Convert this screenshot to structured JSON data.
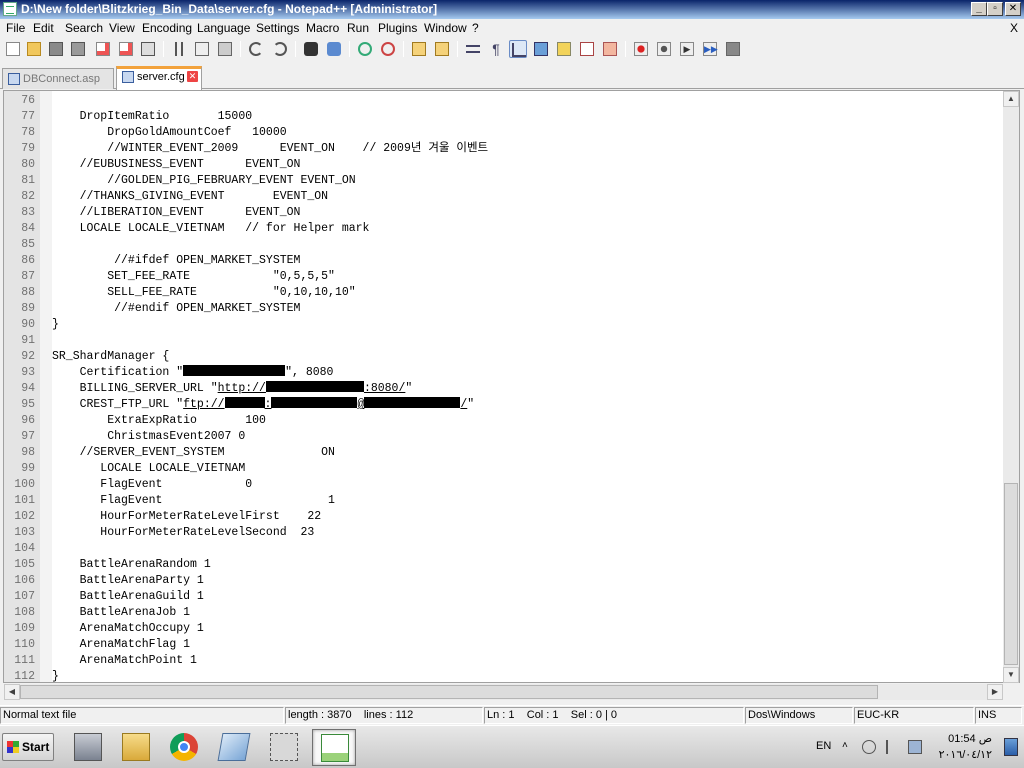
{
  "window": {
    "title": "D:\\New folder\\Blitzkrieg_Bin_Data\\server.cfg - Notepad++ [Administrator]",
    "controls": [
      "minimize",
      "maximize",
      "close"
    ]
  },
  "menu": {
    "items": [
      "File",
      "Edit",
      "Search",
      "View",
      "Encoding",
      "Language",
      "Settings",
      "Macro",
      "Run",
      "Plugins",
      "Window",
      "?"
    ],
    "close_label": "X"
  },
  "toolbar": {
    "icons": [
      "new-file-icon",
      "open-file-icon",
      "save-icon",
      "save-all-icon",
      "close-icon",
      "close-all-icon",
      "print-icon",
      "cut-icon",
      "copy-icon",
      "paste-icon",
      "undo-icon",
      "redo-icon",
      "find-icon",
      "replace-icon",
      "zoom-in-icon",
      "zoom-out-icon",
      "sync-vertical-icon",
      "sync-horizontal-icon",
      "word-wrap-icon",
      "show-all-characters-icon",
      "indent-guide-icon",
      "user-language-icon",
      "function-list-icon",
      "folder-as-workspace-icon",
      "document-map-icon",
      "record-macro-icon",
      "stop-recording-icon",
      "play-macro-icon",
      "run-macro-multiple-icon",
      "save-macro-icon"
    ]
  },
  "tabs": [
    {
      "label": "DBConnect.asp",
      "active": false
    },
    {
      "label": "server.cfg",
      "active": true
    }
  ],
  "editor": {
    "lines": [
      {
        "n": "76",
        "text": ""
      },
      {
        "n": "77",
        "text": "    DropItemRatio       15000"
      },
      {
        "n": "78",
        "text": "        DropGoldAmountCoef   10000"
      },
      {
        "n": "79",
        "text": "        //WINTER_EVENT_2009      EVENT_ON    // 2009년 겨울 이벤트"
      },
      {
        "n": "80",
        "text": "    //EUBUSINESS_EVENT      EVENT_ON"
      },
      {
        "n": "81",
        "text": "        //GOLDEN_PIG_FEBRUARY_EVENT EVENT_ON"
      },
      {
        "n": "82",
        "text": "    //THANKS_GIVING_EVENT       EVENT_ON"
      },
      {
        "n": "83",
        "text": "    //LIBERATION_EVENT      EVENT_ON"
      },
      {
        "n": "84",
        "text": "    LOCALE LOCALE_VIETNAM   // for Helper mark"
      },
      {
        "n": "85",
        "text": ""
      },
      {
        "n": "86",
        "text": "         //#ifdef OPEN_MARKET_SYSTEM"
      },
      {
        "n": "87",
        "text": "        SET_FEE_RATE            \"0,5,5,5\""
      },
      {
        "n": "88",
        "text": "        SELL_FEE_RATE           \"0,10,10,10\""
      },
      {
        "n": "89",
        "text": "         //#endif OPEN_MARKET_SYSTEM"
      },
      {
        "n": "90",
        "text": "}"
      },
      {
        "n": "91",
        "text": ""
      },
      {
        "n": "92",
        "text": "SR_ShardManager {"
      },
      {
        "n": "93",
        "text": "    Certification \"",
        "redact_w": 102,
        "after": "\", 8080"
      },
      {
        "n": "94",
        "text": "    BILLING_SERVER_URL \"",
        "link_pre": "http://",
        "redact_w": 98,
        "link_post": ":8080/",
        "after": "\""
      },
      {
        "n": "95",
        "text": "    CREST_FTP_URL \"",
        "link_pre": "ftp://",
        "redact_w": 40,
        "mid": ":",
        "redact_w2": 86,
        "mid2": "@",
        "redact_w3": 96,
        "link_post": "/",
        "after": "\""
      },
      {
        "n": "96",
        "text": "        ExtraExpRatio       100"
      },
      {
        "n": "97",
        "text": "        ChristmasEvent2007 0"
      },
      {
        "n": "98",
        "text": "    //SERVER_EVENT_SYSTEM              ON"
      },
      {
        "n": "99",
        "text": "       LOCALE LOCALE_VIETNAM"
      },
      {
        "n": "100",
        "text": "       FlagEvent            0"
      },
      {
        "n": "101",
        "text": "       FlagEvent                        1"
      },
      {
        "n": "102",
        "text": "       HourForMeterRateLevelFirst    22"
      },
      {
        "n": "103",
        "text": "       HourForMeterRateLevelSecond  23"
      },
      {
        "n": "104",
        "text": ""
      },
      {
        "n": "105",
        "text": "    BattleArenaRandom 1"
      },
      {
        "n": "106",
        "text": "    BattleArenaParty 1"
      },
      {
        "n": "107",
        "text": "    BattleArenaGuild 1"
      },
      {
        "n": "108",
        "text": "    BattleArenaJob 1"
      },
      {
        "n": "109",
        "text": "    ArenaMatchOccupy 1"
      },
      {
        "n": "110",
        "text": "    ArenaMatchFlag 1"
      },
      {
        "n": "111",
        "text": "    ArenaMatchPoint 1"
      },
      {
        "n": "112",
        "text": "}"
      }
    ]
  },
  "statusbar": {
    "type": "Normal text file",
    "length": "length : 3870",
    "lines": "lines : 112",
    "position": "Ln : 1    Col : 1    Sel : 0 | 0",
    "eol": "Dos\\Windows",
    "encoding": "EUC-KR",
    "mode": "INS"
  },
  "taskbar": {
    "start_label": "Start",
    "apps": [
      "server-manager-icon",
      "explorer-icon",
      "chrome-icon",
      "notepad-icon",
      "config-tools-icon",
      "notepad-plus-plus-icon"
    ],
    "language": "EN",
    "clock_time": "01:54 ص",
    "clock_date": "٢٠١٦/٠٤/١٢"
  }
}
